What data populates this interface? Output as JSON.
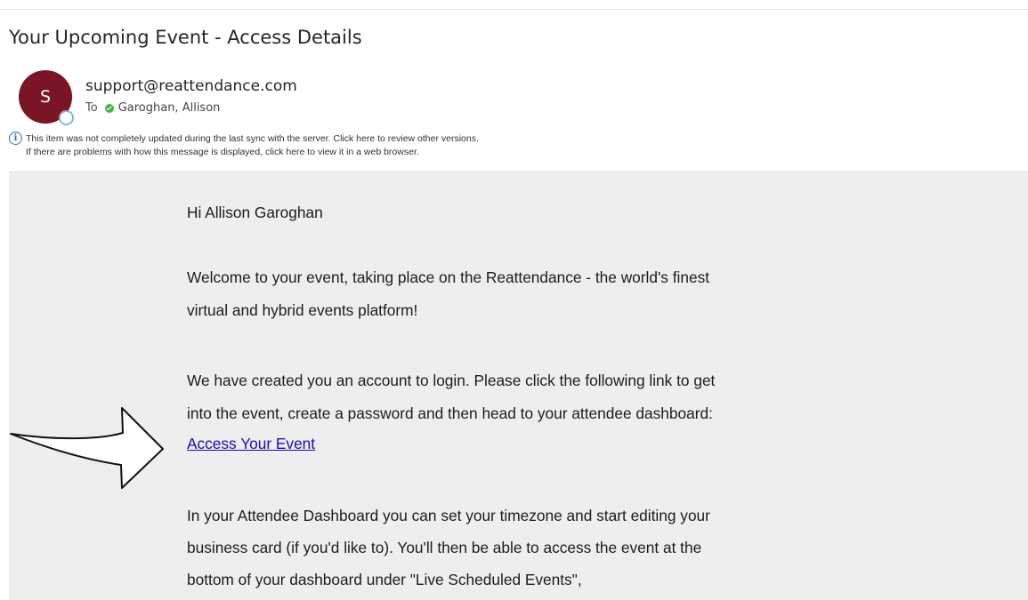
{
  "email": {
    "subject": "Your Upcoming Event - Access Details",
    "avatar_initial": "S",
    "sender": "support@reattendance.com",
    "to_label": "To",
    "recipient": "Garoghan, Allison",
    "info_line1": "This item was not completely updated during the last sync with the server. Click here to review other versions.",
    "info_line2": "If there are problems with how this message is displayed, click here to view it in a web browser.",
    "greeting": "Hi Allison Garoghan",
    "para1_line1": "Welcome to your event, taking place on the Reattendance - the world's finest",
    "para1_line2": "virtual and hybrid events platform!",
    "para2_line1": "We have created you an account to login. Please click the following link to get",
    "para2_line2": "into the event, create a password and then head to your attendee dashboard:",
    "access_link": "Access Your Event",
    "para3_line1": "In your Attendee Dashboard you can set your timezone and start editing your",
    "para3_line2": "business card (if you'd like to). You'll then be able to access the event at the",
    "para3_line3": "bottom of your dashboard under \"Live Scheduled Events\","
  },
  "icons": {
    "info": "info-icon",
    "presence": "presence-icon",
    "status": "available-status-icon",
    "arrow": "right-arrow-icon"
  },
  "colors": {
    "avatar": "#7b1424",
    "link": "#1a0dab",
    "status_green": "#41b54a",
    "body_bg": "#eeeeee"
  }
}
